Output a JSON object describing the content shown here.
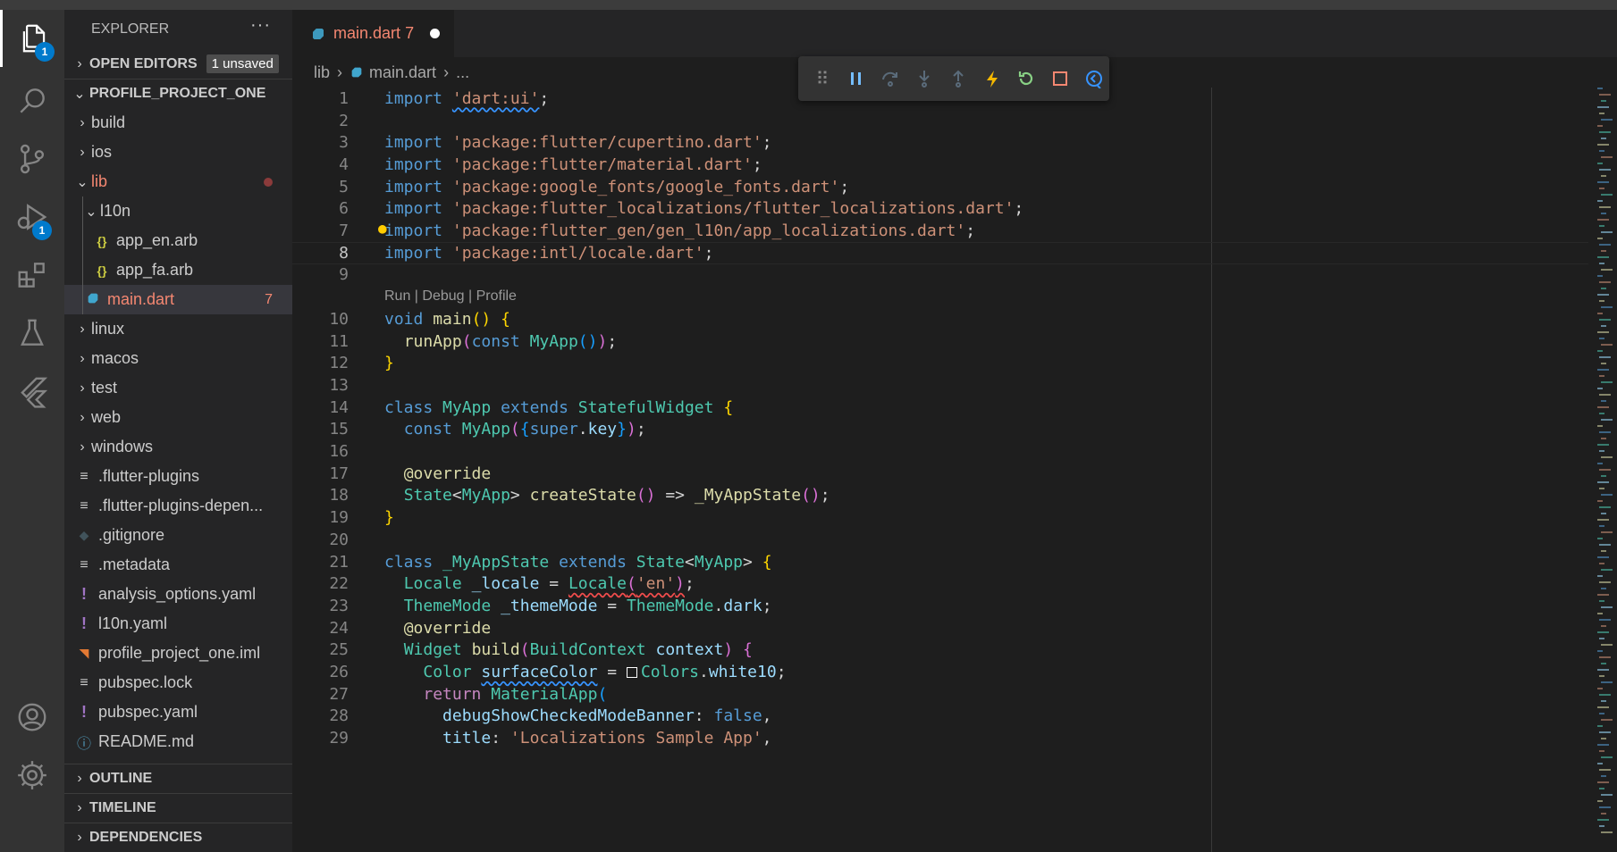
{
  "activity_bar": {
    "items": [
      {
        "icon": "files-icon",
        "badge": "1"
      },
      {
        "icon": "search-icon"
      },
      {
        "icon": "source-control-icon"
      },
      {
        "icon": "run-debug-icon",
        "badge": "1"
      },
      {
        "icon": "extensions-icon"
      },
      {
        "icon": "testing-icon"
      },
      {
        "icon": "flutter-icon"
      }
    ],
    "bottom": [
      {
        "icon": "account-icon"
      },
      {
        "icon": "manage-gear-icon"
      }
    ]
  },
  "sidebar": {
    "title": "EXPLORER",
    "more": "···",
    "open_editors": {
      "label": "OPEN EDITORS",
      "badge": "1 unsaved"
    },
    "project": {
      "label": "PROFILE_PROJECT_ONE"
    },
    "tree": [
      {
        "label": "build",
        "chev": "›",
        "indent": 1
      },
      {
        "label": "ios",
        "chev": "›",
        "indent": 1
      },
      {
        "label": "lib",
        "chev": "⌄",
        "indent": 1,
        "modified": true
      },
      {
        "label": "l10n",
        "chev": "⌄",
        "indent": 2
      },
      {
        "label": "app_en.arb",
        "icon": "{}",
        "indent": 3
      },
      {
        "label": "app_fa.arb",
        "icon": "{}",
        "indent": 3
      },
      {
        "label": "main.dart",
        "icon": "dart",
        "indent": 2,
        "count": "7",
        "selected": true
      },
      {
        "label": "linux",
        "chev": "›",
        "indent": 1
      },
      {
        "label": "macos",
        "chev": "›",
        "indent": 1
      },
      {
        "label": "test",
        "chev": "›",
        "indent": 1
      },
      {
        "label": "web",
        "chev": "›",
        "indent": 1
      },
      {
        "label": "windows",
        "chev": "›",
        "indent": 1
      },
      {
        "label": ".flutter-plugins",
        "icon": "≡",
        "indent": 1
      },
      {
        "label": ".flutter-plugins-depen...",
        "icon": "≡",
        "indent": 1
      },
      {
        "label": ".gitignore",
        "icon": "◆",
        "indent": 1
      },
      {
        "label": ".metadata",
        "icon": "≡",
        "indent": 1
      },
      {
        "label": "analysis_options.yaml",
        "icon": "!",
        "indent": 1
      },
      {
        "label": "l10n.yaml",
        "icon": "!",
        "indent": 1
      },
      {
        "label": "profile_project_one.iml",
        "icon": "rss",
        "indent": 1
      },
      {
        "label": "pubspec.lock",
        "icon": "≡",
        "indent": 1
      },
      {
        "label": "pubspec.yaml",
        "icon": "!",
        "indent": 1
      },
      {
        "label": "README.md",
        "icon": "ⓘ",
        "indent": 1
      }
    ],
    "bottom_sections": [
      "OUTLINE",
      "TIMELINE",
      "DEPENDENCIES"
    ]
  },
  "editor": {
    "tab": {
      "label": "main.dart",
      "count": "7"
    },
    "breadcrumb": [
      "lib",
      "›",
      "main.dart",
      "›",
      "..."
    ],
    "codelens": "Run | Debug | Profile",
    "current_line": 8
  },
  "code_lines": [
    {
      "n": "1",
      "parts": [
        [
          "kw",
          "import"
        ],
        [
          "txt",
          " "
        ],
        [
          "str sq",
          "'dart:ui'"
        ],
        [
          "txt",
          ";"
        ]
      ]
    },
    {
      "n": "2",
      "parts": []
    },
    {
      "n": "3",
      "parts": [
        [
          "kw",
          "import"
        ],
        [
          "txt",
          " "
        ],
        [
          "str",
          "'package:flutter/cupertino.dart'"
        ],
        [
          "txt",
          ";"
        ]
      ]
    },
    {
      "n": "4",
      "parts": [
        [
          "kw",
          "import"
        ],
        [
          "txt",
          " "
        ],
        [
          "str",
          "'package:flutter/material.dart'"
        ],
        [
          "txt",
          ";"
        ]
      ]
    },
    {
      "n": "5",
      "parts": [
        [
          "kw",
          "import"
        ],
        [
          "txt",
          " "
        ],
        [
          "str",
          "'package:google_fonts/google_fonts.dart'"
        ],
        [
          "txt",
          ";"
        ]
      ]
    },
    {
      "n": "6",
      "parts": [
        [
          "kw",
          "import"
        ],
        [
          "txt",
          " "
        ],
        [
          "str",
          "'package:flutter_localizations/flutter_localizations.dart'"
        ],
        [
          "txt",
          ";"
        ]
      ]
    },
    {
      "n": "7",
      "parts": [
        [
          "kw",
          "import"
        ],
        [
          "txt",
          " "
        ],
        [
          "str",
          "'package:flutter_gen/gen_l10n/app_localizations.dart'"
        ],
        [
          "txt",
          ";"
        ]
      ]
    },
    {
      "n": "8",
      "parts": [
        [
          "kw",
          "import"
        ],
        [
          "txt",
          " "
        ],
        [
          "str",
          "'package:intl/locale.dart'"
        ],
        [
          "txt",
          ";"
        ]
      ]
    },
    {
      "n": "9",
      "parts": []
    },
    {
      "n": "10",
      "parts": [
        [
          "kw",
          "void"
        ],
        [
          "txt",
          " "
        ],
        [
          "fn",
          "main"
        ],
        [
          "br1",
          "()"
        ],
        [
          "txt",
          " "
        ],
        [
          "br1",
          "{"
        ]
      ]
    },
    {
      "n": "11",
      "parts": [
        [
          "txt",
          "  "
        ],
        [
          "fn",
          "runApp"
        ],
        [
          "br2",
          "("
        ],
        [
          "kw",
          "const"
        ],
        [
          "txt",
          " "
        ],
        [
          "ty",
          "MyApp"
        ],
        [
          "br3",
          "()"
        ],
        [
          "br2",
          ")"
        ],
        [
          "txt",
          ";"
        ]
      ]
    },
    {
      "n": "12",
      "parts": [
        [
          "br1",
          "}"
        ]
      ]
    },
    {
      "n": "13",
      "parts": []
    },
    {
      "n": "14",
      "parts": [
        [
          "kw",
          "class"
        ],
        [
          "txt",
          " "
        ],
        [
          "ty",
          "MyApp"
        ],
        [
          "txt",
          " "
        ],
        [
          "kw",
          "extends"
        ],
        [
          "txt",
          " "
        ],
        [
          "ty",
          "StatefulWidget"
        ],
        [
          "txt",
          " "
        ],
        [
          "br1",
          "{"
        ]
      ]
    },
    {
      "n": "15",
      "parts": [
        [
          "txt",
          "  "
        ],
        [
          "kw",
          "const"
        ],
        [
          "txt",
          " "
        ],
        [
          "ty",
          "MyApp"
        ],
        [
          "br2",
          "("
        ],
        [
          "br3",
          "{"
        ],
        [
          "kw",
          "super"
        ],
        [
          "txt",
          "."
        ],
        [
          "var",
          "key"
        ],
        [
          "br3",
          "}"
        ],
        [
          "br2",
          ")"
        ],
        [
          "txt",
          ";"
        ]
      ]
    },
    {
      "n": "16",
      "parts": []
    },
    {
      "n": "17",
      "parts": [
        [
          "txt",
          "  "
        ],
        [
          "fn",
          "@override"
        ]
      ]
    },
    {
      "n": "18",
      "parts": [
        [
          "txt",
          "  "
        ],
        [
          "ty",
          "State"
        ],
        [
          "txt",
          "<"
        ],
        [
          "ty",
          "MyApp"
        ],
        [
          "txt",
          "> "
        ],
        [
          "fn",
          "createState"
        ],
        [
          "br2",
          "()"
        ],
        [
          "txt",
          " => "
        ],
        [
          "fn",
          "_MyAppState"
        ],
        [
          "br2",
          "()"
        ],
        [
          "txt",
          ";"
        ]
      ]
    },
    {
      "n": "19",
      "parts": [
        [
          "br1",
          "}"
        ]
      ]
    },
    {
      "n": "20",
      "parts": []
    },
    {
      "n": "21",
      "parts": [
        [
          "kw",
          "class"
        ],
        [
          "txt",
          " "
        ],
        [
          "ty",
          "_MyAppState"
        ],
        [
          "txt",
          " "
        ],
        [
          "kw",
          "extends"
        ],
        [
          "txt",
          " "
        ],
        [
          "ty",
          "State"
        ],
        [
          "txt",
          "<"
        ],
        [
          "ty",
          "MyApp"
        ],
        [
          "txt",
          "> "
        ],
        [
          "br1",
          "{"
        ]
      ]
    },
    {
      "n": "22",
      "parts": [
        [
          "txt",
          "  "
        ],
        [
          "ty",
          "Locale"
        ],
        [
          "txt",
          " "
        ],
        [
          "var",
          "_locale"
        ],
        [
          "txt",
          " = "
        ],
        [
          "ty sqr",
          "Locale"
        ],
        [
          "br2 sqr",
          "("
        ],
        [
          "str sqr",
          "'en'"
        ],
        [
          "br2 sqr",
          ")"
        ],
        [
          "txt",
          ";"
        ]
      ]
    },
    {
      "n": "23",
      "parts": [
        [
          "txt",
          "  "
        ],
        [
          "ty",
          "ThemeMode"
        ],
        [
          "txt",
          " "
        ],
        [
          "var",
          "_themeMode"
        ],
        [
          "txt",
          " = "
        ],
        [
          "ty",
          "ThemeMode"
        ],
        [
          "txt",
          "."
        ],
        [
          "var",
          "dark"
        ],
        [
          "txt",
          ";"
        ]
      ]
    },
    {
      "n": "24",
      "parts": [
        [
          "txt",
          "  "
        ],
        [
          "fn",
          "@override"
        ]
      ]
    },
    {
      "n": "25",
      "parts": [
        [
          "txt",
          "  "
        ],
        [
          "ty",
          "Widget"
        ],
        [
          "txt",
          " "
        ],
        [
          "fn",
          "build"
        ],
        [
          "br2",
          "("
        ],
        [
          "ty",
          "BuildContext"
        ],
        [
          "txt",
          " "
        ],
        [
          "var",
          "context"
        ],
        [
          "br2",
          ")"
        ],
        [
          "txt",
          " "
        ],
        [
          "br2",
          "{"
        ]
      ]
    },
    {
      "n": "26",
      "parts": [
        [
          "txt",
          "    "
        ],
        [
          "ty",
          "Color"
        ],
        [
          "txt",
          " "
        ],
        [
          "var sq",
          "surfaceColor"
        ],
        [
          "txt",
          " = "
        ],
        [
          "swatch",
          "□"
        ],
        [
          "ty",
          "Colors"
        ],
        [
          "txt",
          "."
        ],
        [
          "var",
          "white10"
        ],
        [
          "txt",
          ";"
        ]
      ]
    },
    {
      "n": "27",
      "parts": [
        [
          "txt",
          "    "
        ],
        [
          "kw2",
          "return"
        ],
        [
          "txt",
          " "
        ],
        [
          "ty",
          "MaterialApp"
        ],
        [
          "br3",
          "("
        ]
      ]
    },
    {
      "n": "28",
      "parts": [
        [
          "txt",
          "      "
        ],
        [
          "var",
          "debugShowCheckedModeBanner"
        ],
        [
          "txt",
          ": "
        ],
        [
          "kw",
          "false"
        ],
        [
          "txt",
          ","
        ]
      ]
    },
    {
      "n": "29",
      "parts": [
        [
          "txt",
          "      "
        ],
        [
          "var",
          "title"
        ],
        [
          "txt",
          ": "
        ],
        [
          "str",
          "'Localizations Sample App'"
        ],
        [
          "txt",
          ","
        ]
      ]
    }
  ]
}
